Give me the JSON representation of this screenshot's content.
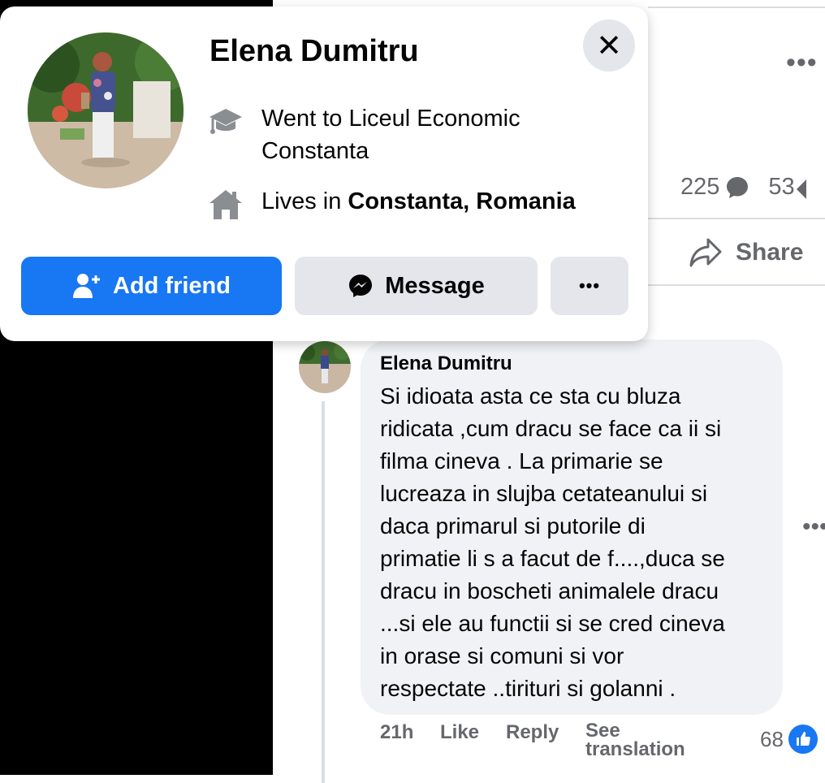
{
  "hover_card": {
    "name": "Elena Dumitru",
    "education": "Went to Liceul Economic Constanta",
    "lives_prefix": "Lives in ",
    "lives_place": "Constanta, Romania",
    "add_friend_label": "Add friend",
    "message_label": "Message",
    "more_label": "•••",
    "close_label": "✕"
  },
  "post": {
    "more_label": "•••",
    "comment_count": "225",
    "share_count": "53",
    "share_label": "Share"
  },
  "comment": {
    "author": "Elena Dumitru",
    "text": "Si idioata asta ce sta cu bluza\nridicata ,cum dracu se face ca ii si\nfilma cineva . La primarie se\nlucreaza in slujba cetateanului si\ndaca primarul si putorile di\nprimatie li s a facut de f....,duca se\ndracu in boscheti animalele dracu\n...si ele au functii si se cred cineva\nin orase si comuni si vor\nrespectate ..tirituri si golanni .",
    "time": "21h",
    "like_label": "Like",
    "reply_label": "Reply",
    "see_translation_label": "See\ntranslation",
    "reaction_count": "68",
    "more_label": "•••"
  },
  "colors": {
    "accent": "#1877f2",
    "secondary_button": "#e4e6eb",
    "comment_bubble": "#f0f2f5",
    "muted_text": "#65676b",
    "icon_gray": "#8a8d91"
  },
  "icons": [
    "close-icon",
    "graduation-cap-icon",
    "home-icon",
    "add-friend-icon",
    "messenger-icon",
    "comment-bubble-icon",
    "share-icon",
    "like-icon",
    "ellipsis-icon"
  ]
}
